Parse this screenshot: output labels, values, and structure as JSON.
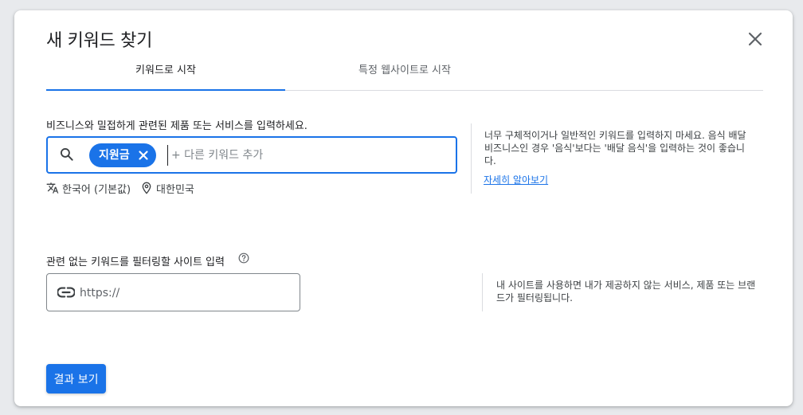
{
  "dialog": {
    "title": "새 키워드 찾기",
    "close_icon": "close-icon"
  },
  "tabs": [
    {
      "label": "키워드로 시작",
      "active": true
    },
    {
      "label": "특정 웹사이트로 시작",
      "active": false
    }
  ],
  "keywords": {
    "label": "비즈니스와 밀접하게 관련된 제품 또는 서비스를 입력하세요.",
    "chips": [
      "지원금"
    ],
    "placeholder": "+ 다른 키워드 추가",
    "language": "한국어 (기본값)",
    "location": "대한민국",
    "help_text": "너무 구체적이거나 일반적인 키워드를 입력하지 마세요. 음식 배달 비즈니스인 경우 '음식'보다는 '배달 음식'을 입력하는 것이 좋습니다.",
    "help_link": "자세히 알아보기"
  },
  "site_filter": {
    "label": "관련 없는 키워드를 필터링할 사이트 입력",
    "placeholder": "https://",
    "help_text": "내 사이트를 사용하면 내가 제공하지 않는 서비스, 제품 또는 브랜드가 필터링됩니다."
  },
  "actions": {
    "submit_label": "결과 보기"
  },
  "colors": {
    "primary": "#1a73e8",
    "text": "#202124",
    "secondary_text": "#5f6368",
    "divider": "#dadce0"
  }
}
